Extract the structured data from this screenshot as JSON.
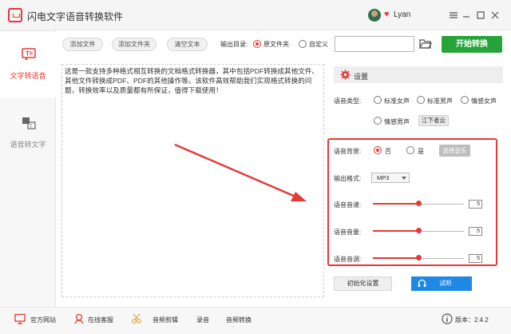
{
  "app": {
    "title": "闪电文字语音转换软件",
    "username": "Lyan"
  },
  "colors": {
    "accent": "#e53935",
    "start_green": "#26a43a",
    "listen_blue": "#1e88e5"
  },
  "window_controls": [
    "menu-icon",
    "minimize-icon",
    "maximize-icon",
    "close-icon"
  ],
  "sidebar": {
    "items": [
      {
        "label": "文字转语音",
        "icon": "text-to-speech-icon",
        "active": true
      },
      {
        "label": "语音转文字",
        "icon": "speech-to-text-icon",
        "active": false
      }
    ]
  },
  "toolbar": {
    "add_file": "添加文件",
    "add_folder": "添加文件夹",
    "clear_text": "清空文本",
    "output_dir_label": "输出目录:",
    "output_options": [
      "原文件夹",
      "自定义"
    ],
    "output_selected": "原文件夹",
    "path_value": "",
    "start": "开始转换"
  },
  "text_content": "这是一款支持多种格式相互转换的文档格式转换器，其中包括PDF转换成其他文件、其他文件转换成PDF、PDF的其他操作等。该软件高效帮助我们实现格式转换的问题，转换效率以及质量都有所保证，值得下载使用！",
  "settings": {
    "title": "设置",
    "voice_type_label": "语音类型:",
    "voice_types": [
      "标准女声",
      "标准男声",
      "情感女声",
      "情感男声"
    ],
    "voice_more_button": "江下者云",
    "bg_label": "语音背景:",
    "bg_options": [
      "否",
      "是"
    ],
    "bg_selected": "否",
    "choose_music": "选择音乐",
    "format_label": "输出格式:",
    "format_value": "MP3",
    "speed_label": "语音音速:",
    "speed_value": "5",
    "volume_label": "语音音量:",
    "volume_value": "5",
    "pitch_label": "语音音调:",
    "pitch_value": "5",
    "slider_level": 0.5,
    "reset_button": "初始化设置",
    "listen_button": "试听"
  },
  "footer": {
    "official_site": "官方网站",
    "online_service": "在线客服",
    "audio_cut": "音频剪辑",
    "record": "录音",
    "audio_convert": "音频转换",
    "version": "版本：2.4.2"
  }
}
